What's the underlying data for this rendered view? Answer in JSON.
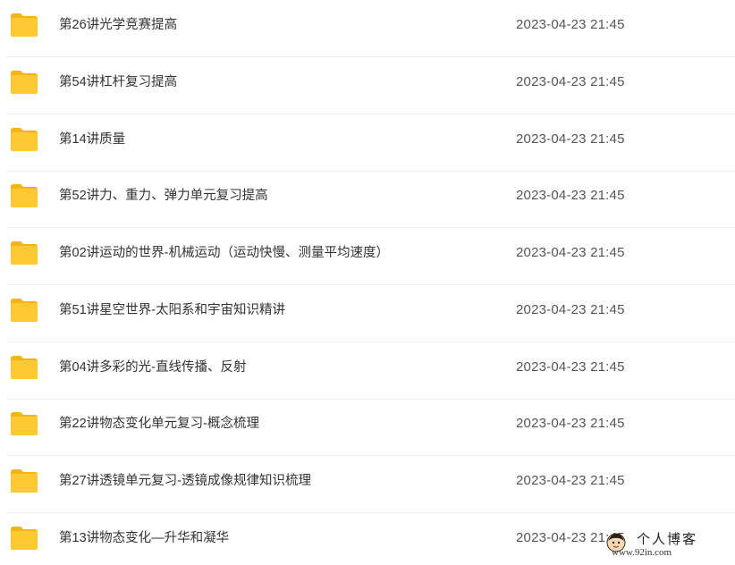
{
  "files": [
    {
      "name": "第26讲光学竞赛提高",
      "date": "2023-04-23 21:45"
    },
    {
      "name": "第54讲杠杆复习提高",
      "date": "2023-04-23 21:45"
    },
    {
      "name": "第14讲质量",
      "date": "2023-04-23 21:45"
    },
    {
      "name": "第52讲力、重力、弹力单元复习提高",
      "date": "2023-04-23 21:45"
    },
    {
      "name": "第02讲运动的世界-机械运动（运动快慢、测量平均速度）",
      "date": "2023-04-23 21:45"
    },
    {
      "name": "第51讲星空世界-太阳系和宇宙知识精讲",
      "date": "2023-04-23 21:45"
    },
    {
      "name": "第04讲多彩的光-直线传播、反射",
      "date": "2023-04-23 21:45"
    },
    {
      "name": "第22讲物态变化单元复习-概念梳理",
      "date": "2023-04-23 21:45"
    },
    {
      "name": "第27讲透镜单元复习-透镜成像规律知识梳理",
      "date": "2023-04-23 21:45"
    },
    {
      "name": "第13讲物态变化—升华和凝华",
      "date": "2023-04-23 21:45"
    }
  ],
  "icons": {
    "folder": "folder-icon",
    "watermark_avatar": "avatar-icon"
  },
  "colors": {
    "folder_body": "#FFC933",
    "folder_tab": "#F5B416",
    "divider": "#eeeeee",
    "name_text": "#333333",
    "date_text": "#555555"
  },
  "watermark": {
    "title": "个人博客",
    "url": "www.92in.com"
  }
}
